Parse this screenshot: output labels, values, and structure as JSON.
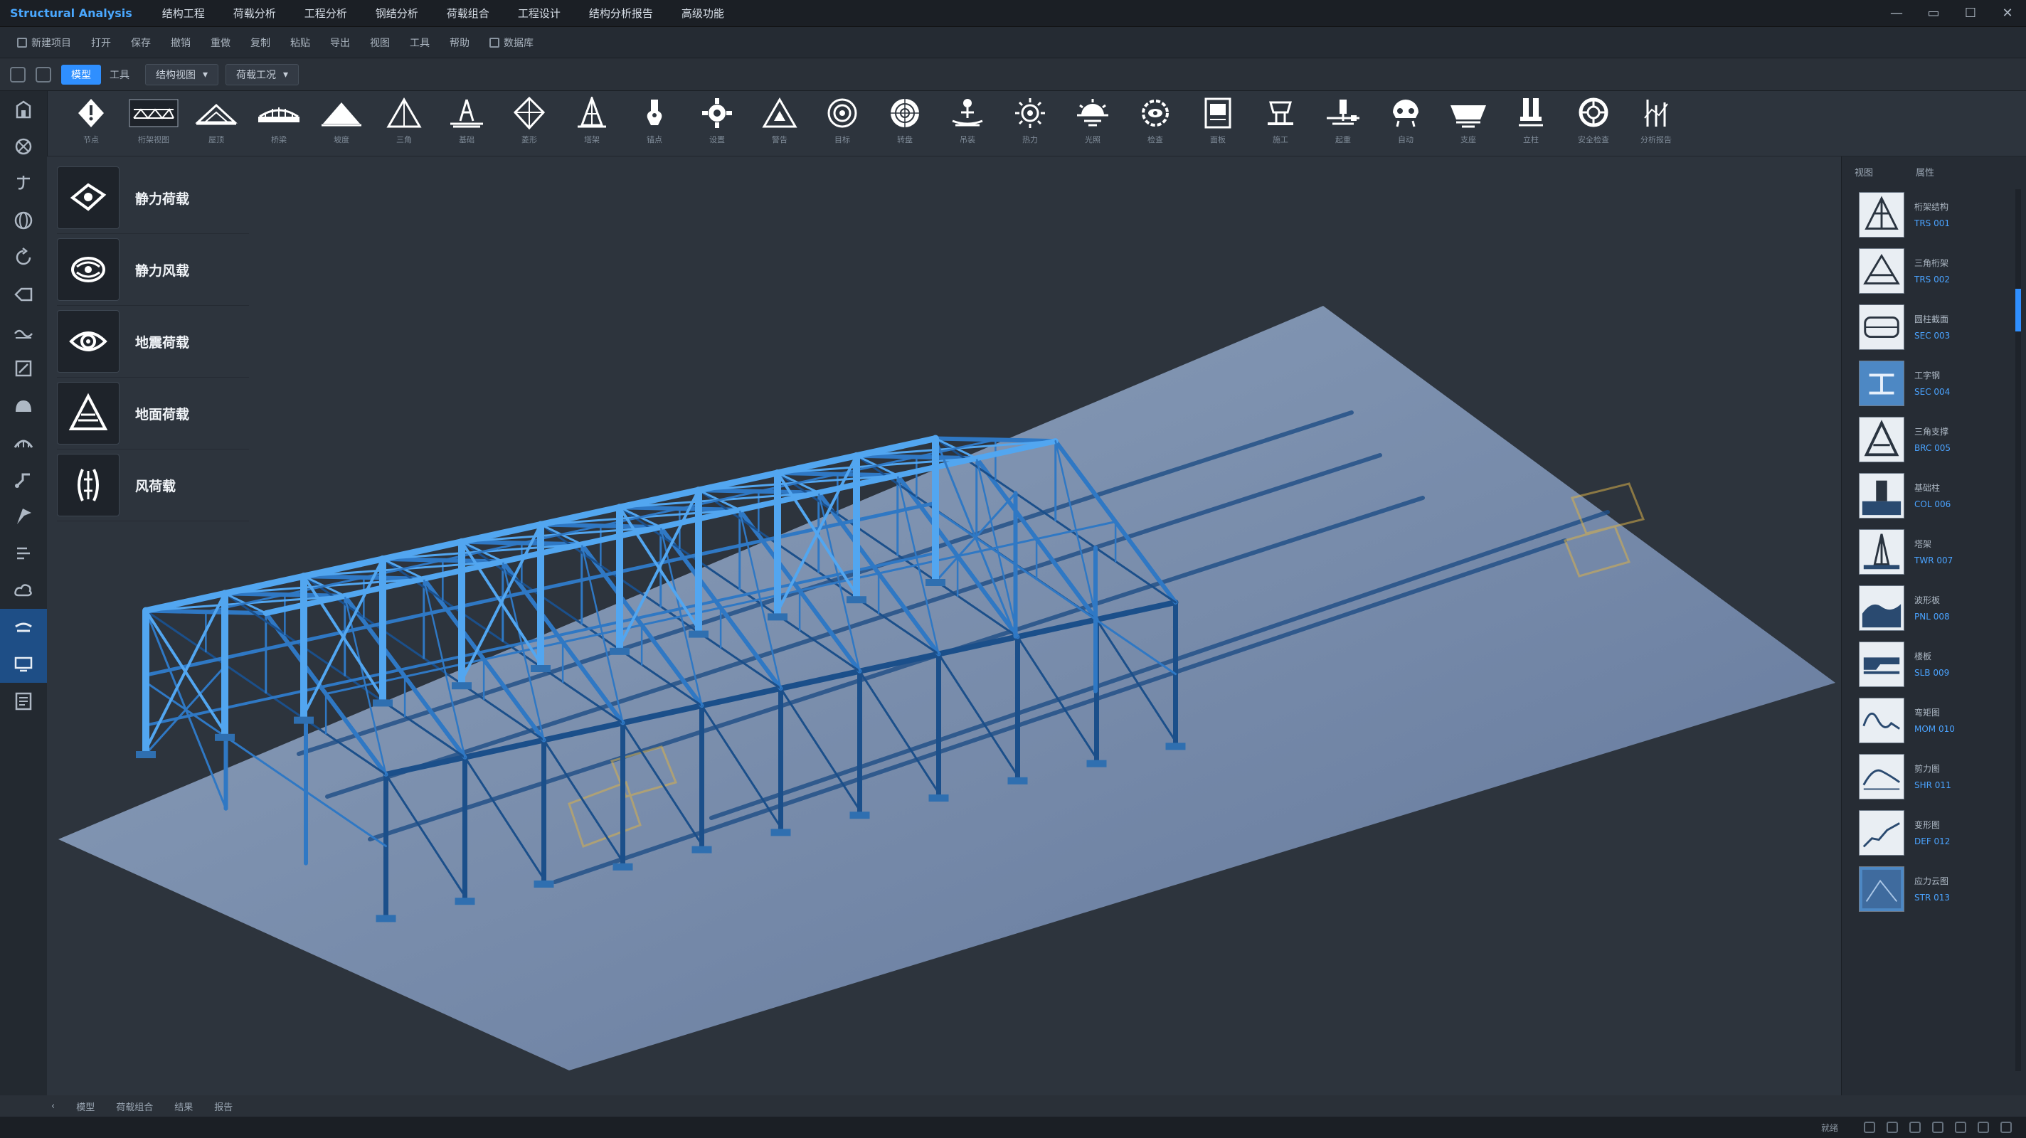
{
  "app": {
    "title": "Structural Analysis",
    "menu": [
      "结构工程",
      "荷载分析",
      "工程分析",
      "钢结分析",
      "荷载组合",
      "工程设计",
      "结构分析报告",
      "高级功能"
    ]
  },
  "window_controls": {
    "minimize": "—",
    "restore": "▭",
    "maximize": "☐",
    "close": "✕"
  },
  "toolbar1": {
    "items": [
      "新建项目",
      "打开",
      "保存",
      "撤销",
      "重做",
      "复制",
      "粘贴",
      "导出",
      "视图",
      "工具",
      "帮助",
      "数据库"
    ]
  },
  "toolbar2": {
    "active_tab": "模型",
    "plain_tab": "工具",
    "dropdown1": "结构视图",
    "dropdown2": "荷载工况"
  },
  "ribbon": {
    "tools": [
      {
        "icon": "node-icon",
        "label": "节点"
      },
      {
        "icon": "truss-view-icon",
        "label": "桁架视图"
      },
      {
        "icon": "roof-icon",
        "label": "屋顶"
      },
      {
        "icon": "bridge-icon",
        "label": "桥梁"
      },
      {
        "icon": "mountain-icon",
        "label": "坡度"
      },
      {
        "icon": "triangle-icon",
        "label": "三角"
      },
      {
        "icon": "tower-base-icon",
        "label": "基础"
      },
      {
        "icon": "diamond-icon",
        "label": "菱形"
      },
      {
        "icon": "pylon-icon",
        "label": "塔架"
      },
      {
        "icon": "anchor-icon",
        "label": "锚点"
      },
      {
        "icon": "gear-icon",
        "label": "设置"
      },
      {
        "icon": "warning-triangle-icon",
        "label": "警告"
      },
      {
        "icon": "target-icon",
        "label": "目标"
      },
      {
        "icon": "wheel-icon",
        "label": "转盘"
      },
      {
        "icon": "person-lift-icon",
        "label": "吊装"
      },
      {
        "icon": "sun-gear-icon",
        "label": "热力"
      },
      {
        "icon": "sun-icon",
        "label": "光照"
      },
      {
        "icon": "cog-eye-icon",
        "label": "检查"
      },
      {
        "icon": "panel-icon",
        "label": "面板"
      },
      {
        "icon": "hammer-icon",
        "label": "施工"
      },
      {
        "icon": "crane-icon",
        "label": "起重"
      },
      {
        "icon": "robot-icon",
        "label": "自动"
      },
      {
        "icon": "bowl-icon",
        "label": "支座"
      },
      {
        "icon": "column-icon",
        "label": "立柱"
      },
      {
        "icon": "lifebuoy-icon",
        "label": "安全检查"
      },
      {
        "icon": "chart-icon",
        "label": "分析报告"
      }
    ]
  },
  "left_strip": {
    "icons": [
      "building-icon",
      "network-icon",
      "hook-icon",
      "globe-icon",
      "rotate-icon",
      "tag-icon",
      "wave-icon",
      "resize-icon",
      "dome-icon",
      "arch-icon",
      "pipe-icon",
      "flag-icon",
      "align-icon",
      "cloud-icon",
      "bracket-icon",
      "monitor-icon",
      "report-icon"
    ]
  },
  "load_panel": {
    "items": [
      {
        "icon": "static-load-icon",
        "label": "静力荷载"
      },
      {
        "icon": "dynamic-load-icon",
        "label": "静力风载"
      },
      {
        "icon": "seismic-load-icon",
        "label": "地震荷载"
      },
      {
        "icon": "snow-load-icon",
        "label": "地面荷载"
      },
      {
        "icon": "wind-load-icon",
        "label": "风荷载"
      }
    ]
  },
  "right_panel": {
    "header": [
      "视图",
      "属性"
    ],
    "items": [
      {
        "name": "桁架结构",
        "sub": "TRS 001"
      },
      {
        "name": "三角桁架",
        "sub": "TRS 002"
      },
      {
        "name": "圆柱截面",
        "sub": "SEC 003"
      },
      {
        "name": "工字钢",
        "sub": "SEC 004"
      },
      {
        "name": "三角支撑",
        "sub": "BRC 005"
      },
      {
        "name": "基础柱",
        "sub": "COL 006"
      },
      {
        "name": "塔架",
        "sub": "TWR 007"
      },
      {
        "name": "波形板",
        "sub": "PNL 008"
      },
      {
        "name": "楼板",
        "sub": "SLB 009"
      },
      {
        "name": "弯矩图",
        "sub": "MOM 010"
      },
      {
        "name": "剪力图",
        "sub": "SHR 011"
      },
      {
        "name": "变形图",
        "sub": "DEF 012"
      },
      {
        "name": "应力云图",
        "sub": "STR 013"
      }
    ]
  },
  "bottom_tabs": [
    "模型",
    "荷载组合",
    "结果",
    "报告"
  ],
  "status_bar": {
    "text": "就绪"
  }
}
